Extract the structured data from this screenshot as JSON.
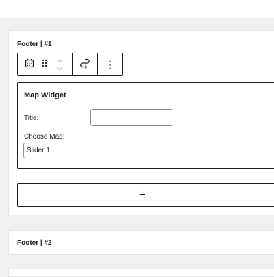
{
  "panels": [
    {
      "title": "Footer | #1"
    },
    {
      "title": "Footer | #2"
    }
  ],
  "toolbar": {
    "calendar_icon": "calendar-icon",
    "drag_icon": "drag-handle-icon",
    "move_up_icon": "chevron-up-icon",
    "move_down_icon": "chevron-down-icon",
    "transform_icon": "transform-loop-icon",
    "more_icon": "vertical-ellipsis-icon",
    "more_glyph": "⋮"
  },
  "widget": {
    "heading": "Map Widget",
    "title_label": "Title:",
    "title_value": "",
    "choose_map_label": "Choose Map:",
    "selected_map": "Slider 1"
  },
  "appender": {
    "icon": "plus-icon",
    "glyph": "+"
  },
  "colors": {
    "background": "#f0f0f0",
    "panel": "#ffffff",
    "border": "#1e1e1e",
    "input_border": "#8c8f94"
  }
}
